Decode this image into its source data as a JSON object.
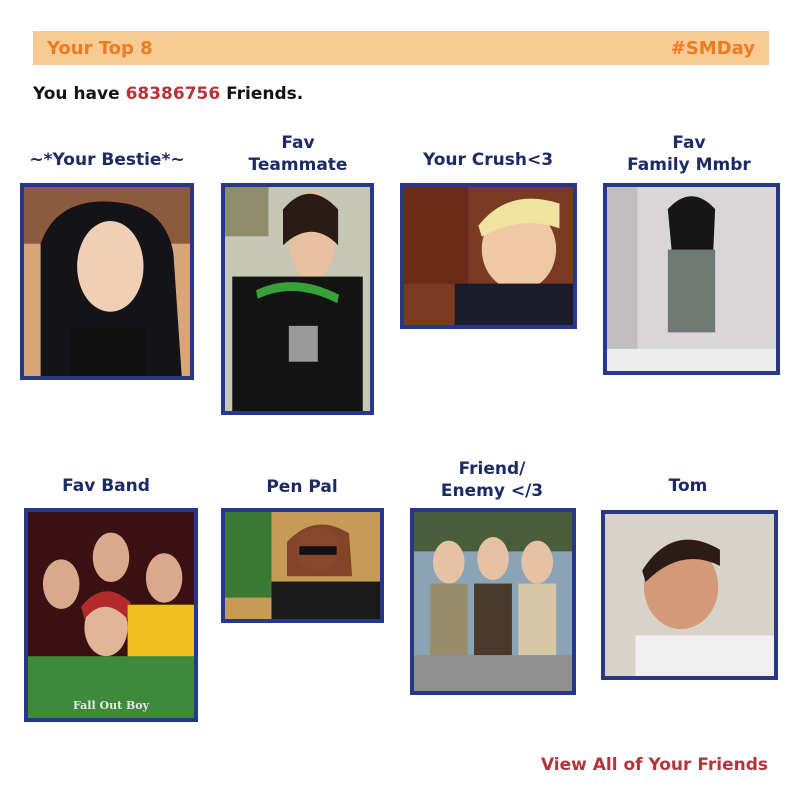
{
  "header": {
    "title": "Your Top 8",
    "hashtag": "#SMDay"
  },
  "summary": {
    "prefix": "You have",
    "count": "68386756",
    "suffix": "Friends."
  },
  "top8": [
    {
      "label_lines": [
        "~*Your Bestie*~"
      ],
      "icon": "person-photo"
    },
    {
      "label_lines": [
        "Fav",
        "Teammate"
      ],
      "icon": "person-photo"
    },
    {
      "label_lines": [
        "Your Crush<3"
      ],
      "icon": "person-photo"
    },
    {
      "label_lines": [
        "Fav",
        "Family Mmbr"
      ],
      "icon": "person-photo"
    },
    {
      "label_lines": [
        "Fav Band"
      ],
      "icon": "band-photo",
      "photo_caption": "Fall Out Boy"
    },
    {
      "label_lines": [
        "Pen Pal"
      ],
      "icon": "person-photo"
    },
    {
      "label_lines": [
        "Friend/",
        "Enemy </3"
      ],
      "icon": "group-photo"
    },
    {
      "label_lines": [
        "Tom"
      ],
      "icon": "person-photo"
    }
  ],
  "footer": {
    "link_text": "View All of Your Friends"
  },
  "colors": {
    "header_bg": "#f8cb95",
    "header_text": "#ec7c22",
    "label": "#1c2a66",
    "frame": "#283888",
    "accent_red": "#b5343a"
  }
}
